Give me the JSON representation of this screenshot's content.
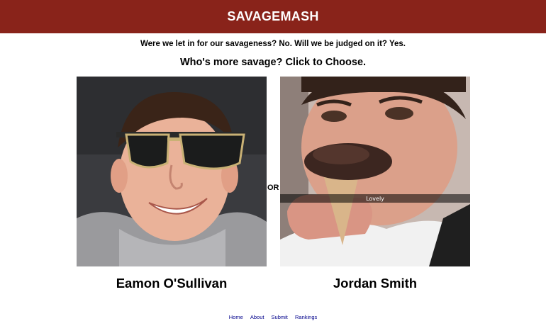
{
  "header": {
    "title": "SAVAGEMASH",
    "background": "#89231a"
  },
  "tagline": "Were we let in for our savageness? No. Will we be judged on it? Yes.",
  "prompt": "Who's more savage? Click to Choose.",
  "contestants": {
    "left": {
      "name": "Eamon O'Sullivan"
    },
    "right": {
      "name": "Jordan Smith",
      "photo_caption": "Lovely"
    }
  },
  "separator": "OR",
  "footer": {
    "links": [
      "Home",
      "About",
      "Submit",
      "Rankings"
    ],
    "link_color": "#00008b"
  }
}
